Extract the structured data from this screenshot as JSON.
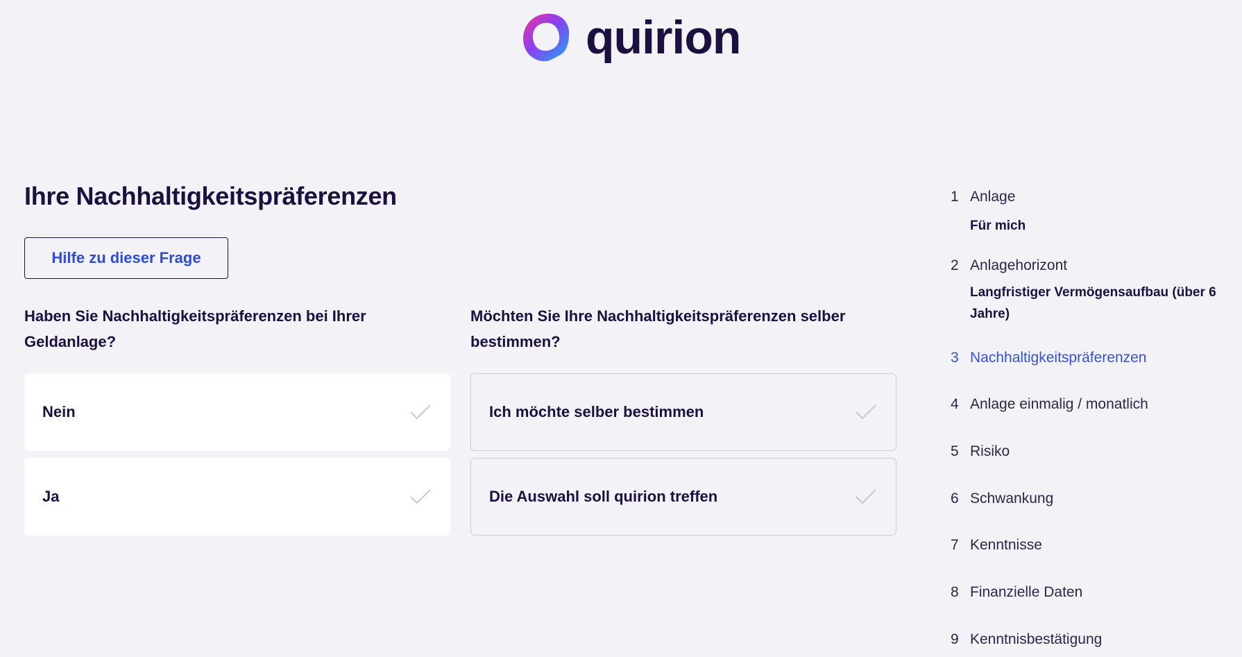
{
  "header": {
    "brand": "quirion"
  },
  "main": {
    "title": "Ihre Nachhaltigkeitspräferenzen",
    "help_button": "Hilfe zu dieser Frage",
    "questions": [
      {
        "text": "Haben Sie Nachhaltigkeitspräferenzen bei Ihrer Geldanlage?",
        "options": [
          "Nein",
          "Ja"
        ]
      },
      {
        "text": "Möchten Sie Ihre Nachhaltigkeitspräferenzen selber bestimmen?",
        "options": [
          "Ich möchte selber bestimmen",
          "Die Auswahl soll quirion treffen"
        ]
      }
    ]
  },
  "steps": [
    {
      "num": "1",
      "label": "Anlage",
      "value": "Für mich"
    },
    {
      "num": "2",
      "label": "Anlagehorizont",
      "value": "Langfristiger Vermögensaufbau (über 6 Jahre)"
    },
    {
      "num": "3",
      "label": "Nachhaltigkeitspräferenzen",
      "active": true
    },
    {
      "num": "4",
      "label": "Anlage einmalig / monatlich"
    },
    {
      "num": "5",
      "label": "Risiko"
    },
    {
      "num": "6",
      "label": "Schwankung"
    },
    {
      "num": "7",
      "label": "Kenntnisse"
    },
    {
      "num": "8",
      "label": "Finanzielle Daten"
    },
    {
      "num": "9",
      "label": "Kenntnisbestätigung"
    }
  ],
  "colors": {
    "brand_dark": "#1c1040",
    "accent_blue": "#2f4bd6",
    "background": "#f3f2f7",
    "check_gray": "#c9c7cf"
  },
  "icons": {
    "logo": "quirion-logo-icon",
    "check": "check-icon"
  }
}
